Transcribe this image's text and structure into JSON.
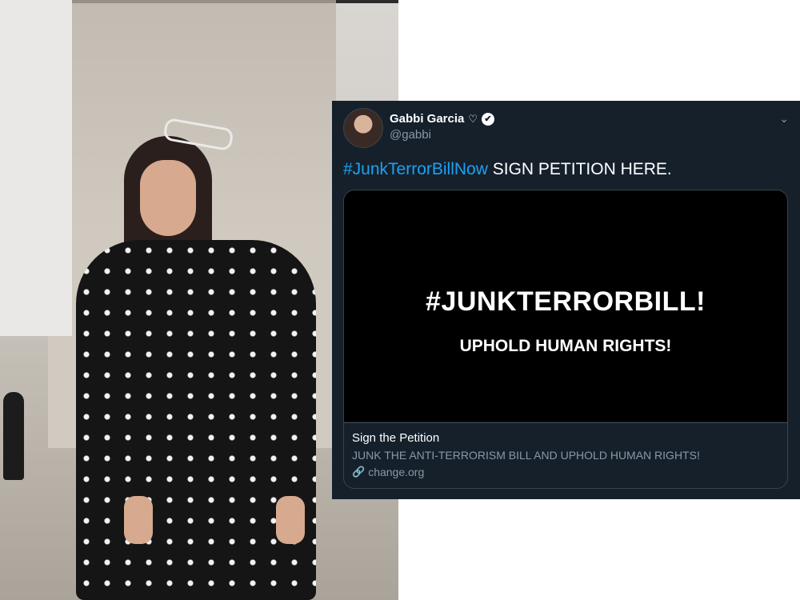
{
  "tweet": {
    "author_name": "Gabbi Garcia",
    "heart_glyph": "♡",
    "verified_glyph": "✔",
    "handle": "@gabbi",
    "caret_glyph": "⌄",
    "hashtag": "#JunkTerrorBillNow",
    "text": " SIGN PETITION HERE.",
    "card": {
      "headline": "#JUNKTERRORBILL!",
      "subheadline": "UPHOLD HUMAN RIGHTS!",
      "title": "Sign the Petition",
      "description": "JUNK THE ANTI-TERRORISM BILL AND UPHOLD HUMAN RIGHTS!",
      "link_glyph": "🔗",
      "domain": "change.org"
    }
  },
  "colors": {
    "tweet_background": "#15202b",
    "hashtag": "#1da1f2",
    "muted_text": "#8899a6",
    "card_border": "#38444d"
  },
  "icons": {
    "verified": "verified-badge-icon",
    "more": "chevron-down-icon",
    "link": "link-icon"
  }
}
